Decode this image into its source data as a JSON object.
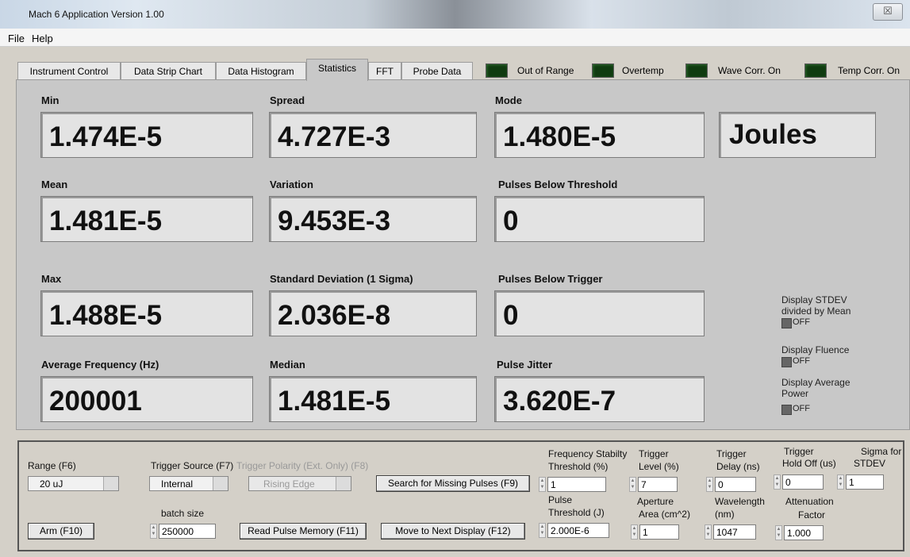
{
  "window": {
    "title": "Mach 6 Application Version 1.00",
    "close_glyph": "☒"
  },
  "menu": {
    "file": "File",
    "help": "Help"
  },
  "tabs": [
    {
      "label": "Instrument Control",
      "active": false
    },
    {
      "label": "Data Strip Chart",
      "active": false
    },
    {
      "label": "Data Histogram",
      "active": false
    },
    {
      "label": "Statistics",
      "active": true
    },
    {
      "label": "FFT",
      "active": false
    },
    {
      "label": "Probe Data",
      "active": false
    }
  ],
  "indicators": [
    {
      "label": "Out of Range",
      "color": "#103b10"
    },
    {
      "label": "Overtemp",
      "color": "#103b10"
    },
    {
      "label": "Wave Corr. On",
      "color": "#103b10"
    },
    {
      "label": "Temp Corr. On",
      "color": "#103b10"
    }
  ],
  "stats": {
    "min": {
      "label": "Min",
      "value": "1.474E-5"
    },
    "spread": {
      "label": "Spread",
      "value": "4.727E-3"
    },
    "mode": {
      "label": "Mode",
      "value": "1.480E-5"
    },
    "units": {
      "value": "Joules"
    },
    "mean": {
      "label": "Mean",
      "value": "1.481E-5"
    },
    "variation": {
      "label": "Variation",
      "value": "9.453E-3"
    },
    "pulses_below_threshold": {
      "label": "Pulses Below Threshold",
      "value": "0"
    },
    "max": {
      "label": "Max",
      "value": "1.488E-5"
    },
    "std_dev": {
      "label": "Standard Deviation (1 Sigma)",
      "value": "2.036E-8"
    },
    "pulses_below_trigger": {
      "label": "Pulses Below Trigger",
      "value": "0"
    },
    "avg_freq": {
      "label": "Average Frequency (Hz)",
      "value": "200001"
    },
    "median": {
      "label": "Median",
      "value": "1.481E-5"
    },
    "pulse_jitter": {
      "label": "Pulse Jitter",
      "value": "3.620E-7"
    }
  },
  "toggles": {
    "stdev_mean": {
      "label1": "Display STDEV",
      "label2": "divided by Mean",
      "state": "OFF"
    },
    "fluence": {
      "label1": "Display Fluence",
      "state": "OFF"
    },
    "avg_power": {
      "label1": "Display Average",
      "label2": "Power",
      "state": "OFF"
    }
  },
  "controls": {
    "range": {
      "label": "Range (F6)",
      "value": "20 uJ"
    },
    "trigger_source": {
      "label": "Trigger Source (F7)",
      "value": "Internal"
    },
    "trigger_polarity": {
      "label": "Trigger Polarity (Ext. Only) (F8)",
      "value": "Rising Edge"
    },
    "search_button": "Search for Missing Pulses (F9)",
    "freq_stability": {
      "label1": "Frequency Stabilty",
      "label2": "Threshold (%)",
      "value": "1"
    },
    "trigger_level": {
      "label1": "Trigger",
      "label2": "Level (%)",
      "value": "7"
    },
    "trigger_delay": {
      "label1": "Trigger",
      "label2": "Delay (ns)",
      "value": "0"
    },
    "trigger_holdoff": {
      "label1": "Trigger",
      "label2": "Hold Off (us)",
      "value": "0"
    },
    "sigma_stdev": {
      "label1": "Sigma for",
      "label2": "STDEV",
      "value": "1"
    },
    "batch_size": {
      "label": "batch size",
      "value": "250000"
    },
    "arm_button": "Arm (F10)",
    "read_button": "Read Pulse Memory (F11)",
    "next_button": "Move to Next Display (F12)",
    "pulse_threshold": {
      "label1": "Pulse",
      "label2": "Threshold (J)",
      "value": "2.000E-6"
    },
    "aperture_area": {
      "label1": "Aperture",
      "label2": "Area (cm^2)",
      "value": "1"
    },
    "wavelength": {
      "label1": "Wavelength",
      "label2": "(nm)",
      "value": "1047"
    },
    "attenuation": {
      "label1": "Attenuation",
      "label2": "Factor",
      "value": "1.000"
    }
  }
}
